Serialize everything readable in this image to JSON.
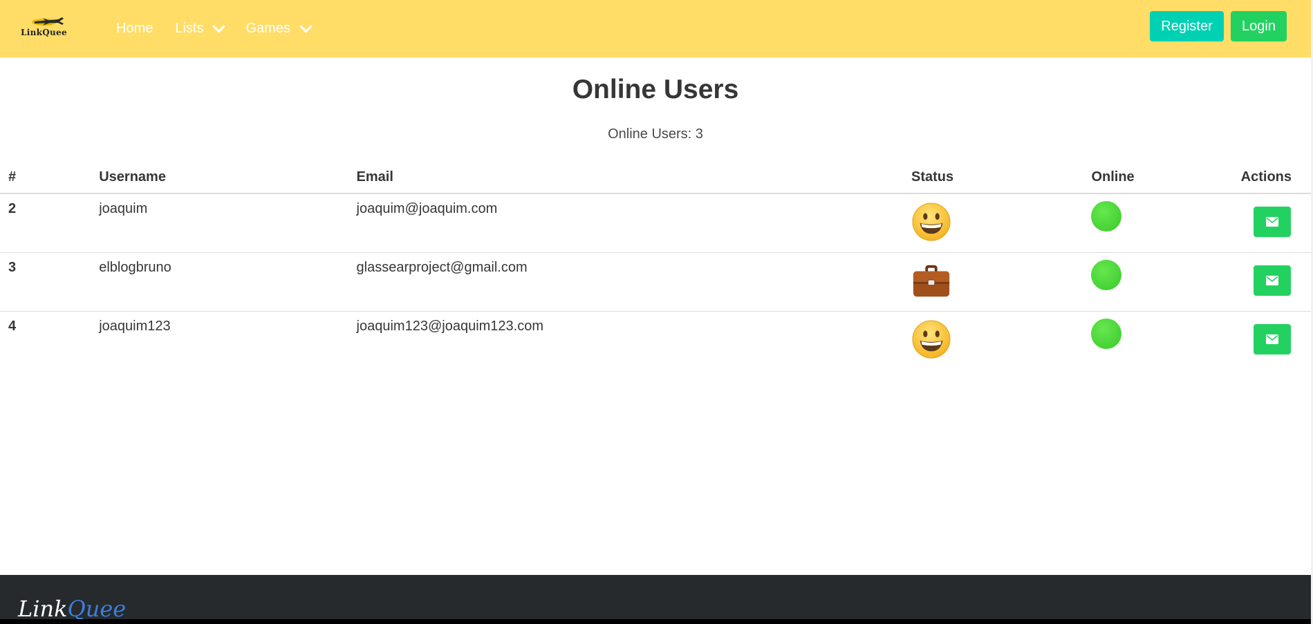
{
  "navbar": {
    "brand_text": "LinkQuee",
    "links": [
      {
        "label": "Home",
        "dropdown": false
      },
      {
        "label": "Lists",
        "dropdown": true
      },
      {
        "label": "Games",
        "dropdown": true
      }
    ],
    "register_label": "Register",
    "login_label": "Login"
  },
  "main": {
    "title": "Online Users",
    "count_text": "Online Users: 3"
  },
  "table": {
    "headers": [
      "#",
      "Username",
      "Email",
      "Status",
      "Online",
      "Actions"
    ],
    "rows": [
      {
        "id": "2",
        "username": "joaquim",
        "email": "joaquim@joaquim.com",
        "status_icon": "grinning-face-icon",
        "online": true
      },
      {
        "id": "3",
        "username": "elblogbruno",
        "email": "glassearproject@gmail.com",
        "status_icon": "briefcase-icon",
        "online": true
      },
      {
        "id": "4",
        "username": "joaquim123",
        "email": "joaquim123@joaquim123.com",
        "status_icon": "grinning-face-icon",
        "online": true
      }
    ]
  },
  "footer": {
    "logo_part1": "Link",
    "logo_part2": "Quee"
  },
  "colors": {
    "navbar_bg": "#ffdd67",
    "register_btn": "#00d1b2",
    "login_btn": "#23d160",
    "mail_btn": "#23d160",
    "online_dot": "#44d535",
    "footer_bg": "#262a2d",
    "footer_logo_accent": "#3d7edb"
  }
}
